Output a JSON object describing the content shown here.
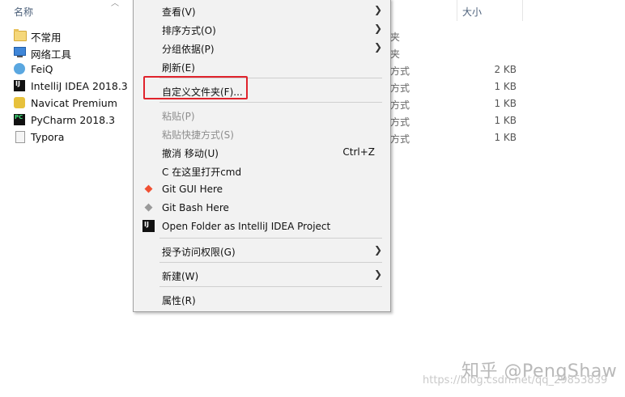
{
  "columns": {
    "name": "名称",
    "size": "大小"
  },
  "files": [
    {
      "name": "不常用",
      "icon": "folder-icon",
      "type": "",
      "size": ""
    },
    {
      "name": "网络工具",
      "icon": "monitor-icon",
      "type": "夹",
      "size": ""
    },
    {
      "name": "FeiQ",
      "icon": "feiq-icon",
      "type": "方式",
      "size": "2 KB"
    },
    {
      "name": "IntelliJ IDEA 2018.3",
      "icon": "intellij-icon",
      "type": "方式",
      "size": "1 KB"
    },
    {
      "name": "Navicat Premium",
      "icon": "navicat-icon",
      "type": "方式",
      "size": "1 KB"
    },
    {
      "name": "PyCharm 2018.3",
      "icon": "pycharm-icon",
      "type": "方式",
      "size": "1 KB"
    },
    {
      "name": "Typora",
      "icon": "typora-icon",
      "type": "方式",
      "size": "1 KB"
    }
  ],
  "bg_type_top": "夹",
  "menu": {
    "view": "查看(V)",
    "sort": "排序方式(O)",
    "group": "分组依据(P)",
    "refresh": "刷新(E)",
    "customize": "自定义文件夹(F)...",
    "paste": "粘贴(P)",
    "paste_shortcut": "粘贴快捷方式(S)",
    "undo": "撤消 移动(U)",
    "undo_shortcut": "Ctrl+Z",
    "open_cmd": "C 在这里打开cmd",
    "git_gui": "Git GUI Here",
    "git_bash": "Git Bash Here",
    "open_idea": "Open Folder as IntelliJ IDEA Project",
    "grant_access": "授予访问权限(G)",
    "new": "新建(W)",
    "properties": "属性(R)"
  },
  "colors": {
    "highlight": "#e0232c",
    "menu_bg": "#f2f2f2"
  },
  "watermark": {
    "main": "知乎 @PengShaw",
    "url": "https://blog.csdn.net/qq_29853839"
  }
}
